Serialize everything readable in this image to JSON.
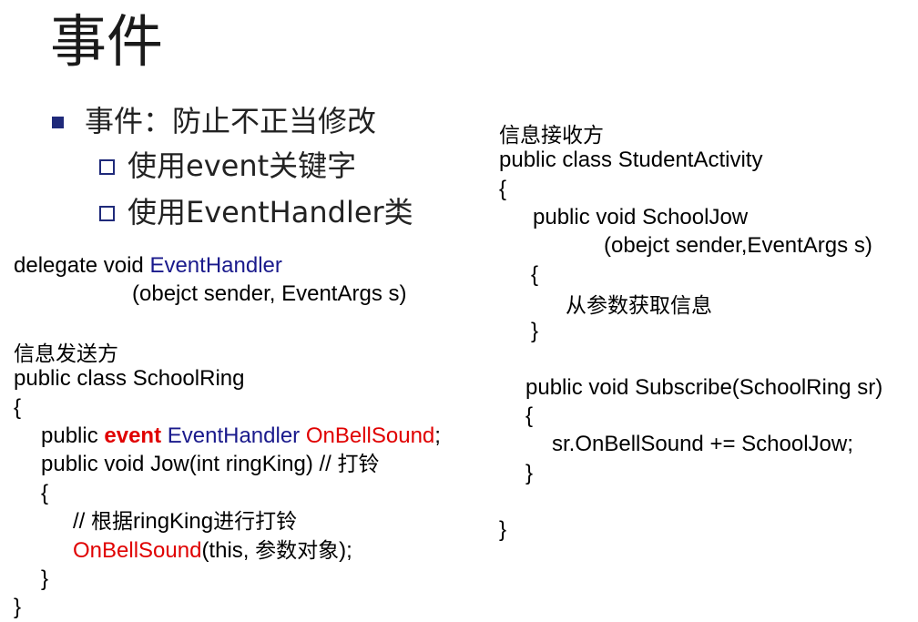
{
  "slide": {
    "title": "事件",
    "bullet_main": "事件：防止不正当修改",
    "sub_bullets": [
      "使用event关键字",
      "使用EventHandler类"
    ]
  },
  "left_code": {
    "delegate_pre": "delegate void ",
    "delegate_type": "EventHandler",
    "delegate_params": "(obejct sender, EventArgs s)",
    "sender_label": "信息发送方",
    "class_decl": "public class SchoolRing",
    "open_brace": "{",
    "event_pre": "public ",
    "event_kw": "event",
    "event_sp": " ",
    "event_type": "EventHandler",
    "event_sp2": " ",
    "event_name": "OnBellSound",
    "event_semi": ";",
    "method_decl": "public void Jow(int ringKing)  // ",
    "method_comment": "打铃",
    "method_open": "{",
    "comment_pre": "// ",
    "comment_cn1": "根据",
    "comment_mid": "ringKing",
    "comment_cn2": "进行打铃",
    "invoke_name": "OnBellSound",
    "invoke_args_pre": "(this, ",
    "invoke_args_cn": "参数对象",
    "invoke_args_post": ");",
    "method_close": "}",
    "class_close": "}"
  },
  "right_code": {
    "receiver_label": "信息接收方",
    "class_decl": "public class StudentActivity",
    "open_brace": "{",
    "method1_decl": "public void SchoolJow",
    "method1_params": "(obejct sender,EventArgs s)",
    "method1_open": "{",
    "method1_body": "从参数获取信息",
    "method1_close": "}",
    "method2_decl": "public void Subscribe(SchoolRing sr)",
    "method2_open": "{",
    "method2_body": "sr.OnBellSound += SchoolJow;",
    "method2_close": "}",
    "class_close": "}"
  }
}
